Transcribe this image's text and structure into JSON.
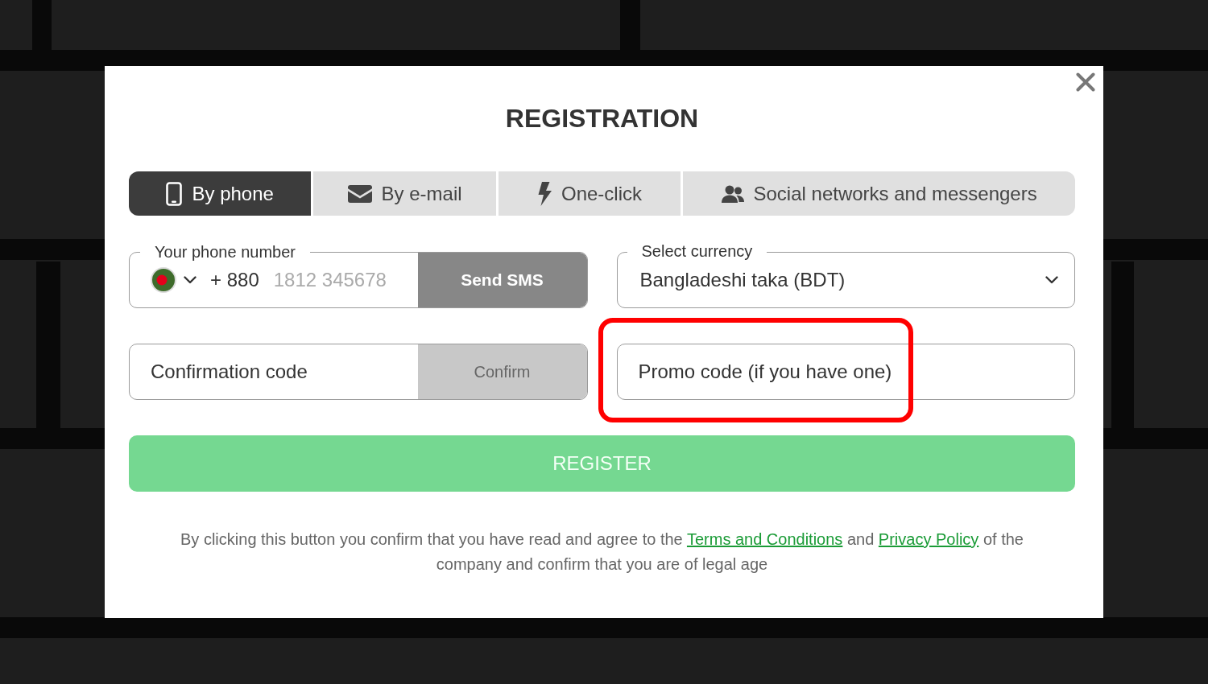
{
  "dialog": {
    "title": "REGISTRATION"
  },
  "tabs": [
    {
      "kind": "phone",
      "label": "By phone",
      "selected": true
    },
    {
      "kind": "email",
      "label": "By e-mail",
      "selected": false
    },
    {
      "kind": "one_click",
      "label": "One-click",
      "selected": false
    },
    {
      "kind": "social",
      "label": "Social networks and messengers",
      "selected": false
    }
  ],
  "phone": {
    "label": "Your phone number",
    "country_code": "+ 880",
    "placeholder": "1812 345678",
    "button": {
      "label": "Send SMS",
      "disabled": false
    }
  },
  "currency": {
    "label": "Select currency",
    "value": "Bangladeshi taka (BDT)"
  },
  "confirmation": {
    "placeholder": "Confirmation code",
    "button": {
      "label": "Confirm",
      "disabled": true
    }
  },
  "promo_code": {
    "placeholder": "Promo code (if you have one)",
    "highlighted": true
  },
  "register_button": {
    "label": "REGISTER"
  },
  "consent": [
    {
      "kind": "text",
      "text": "By clicking this button you confirm that you have read and agree to the "
    },
    {
      "kind": "link",
      "text": "Terms and Conditions"
    },
    {
      "kind": "text",
      "text": " and "
    },
    {
      "kind": "link",
      "text": "Privacy Policy"
    },
    {
      "kind": "text",
      "text": " of the company and confirm that you are of legal age"
    }
  ]
}
